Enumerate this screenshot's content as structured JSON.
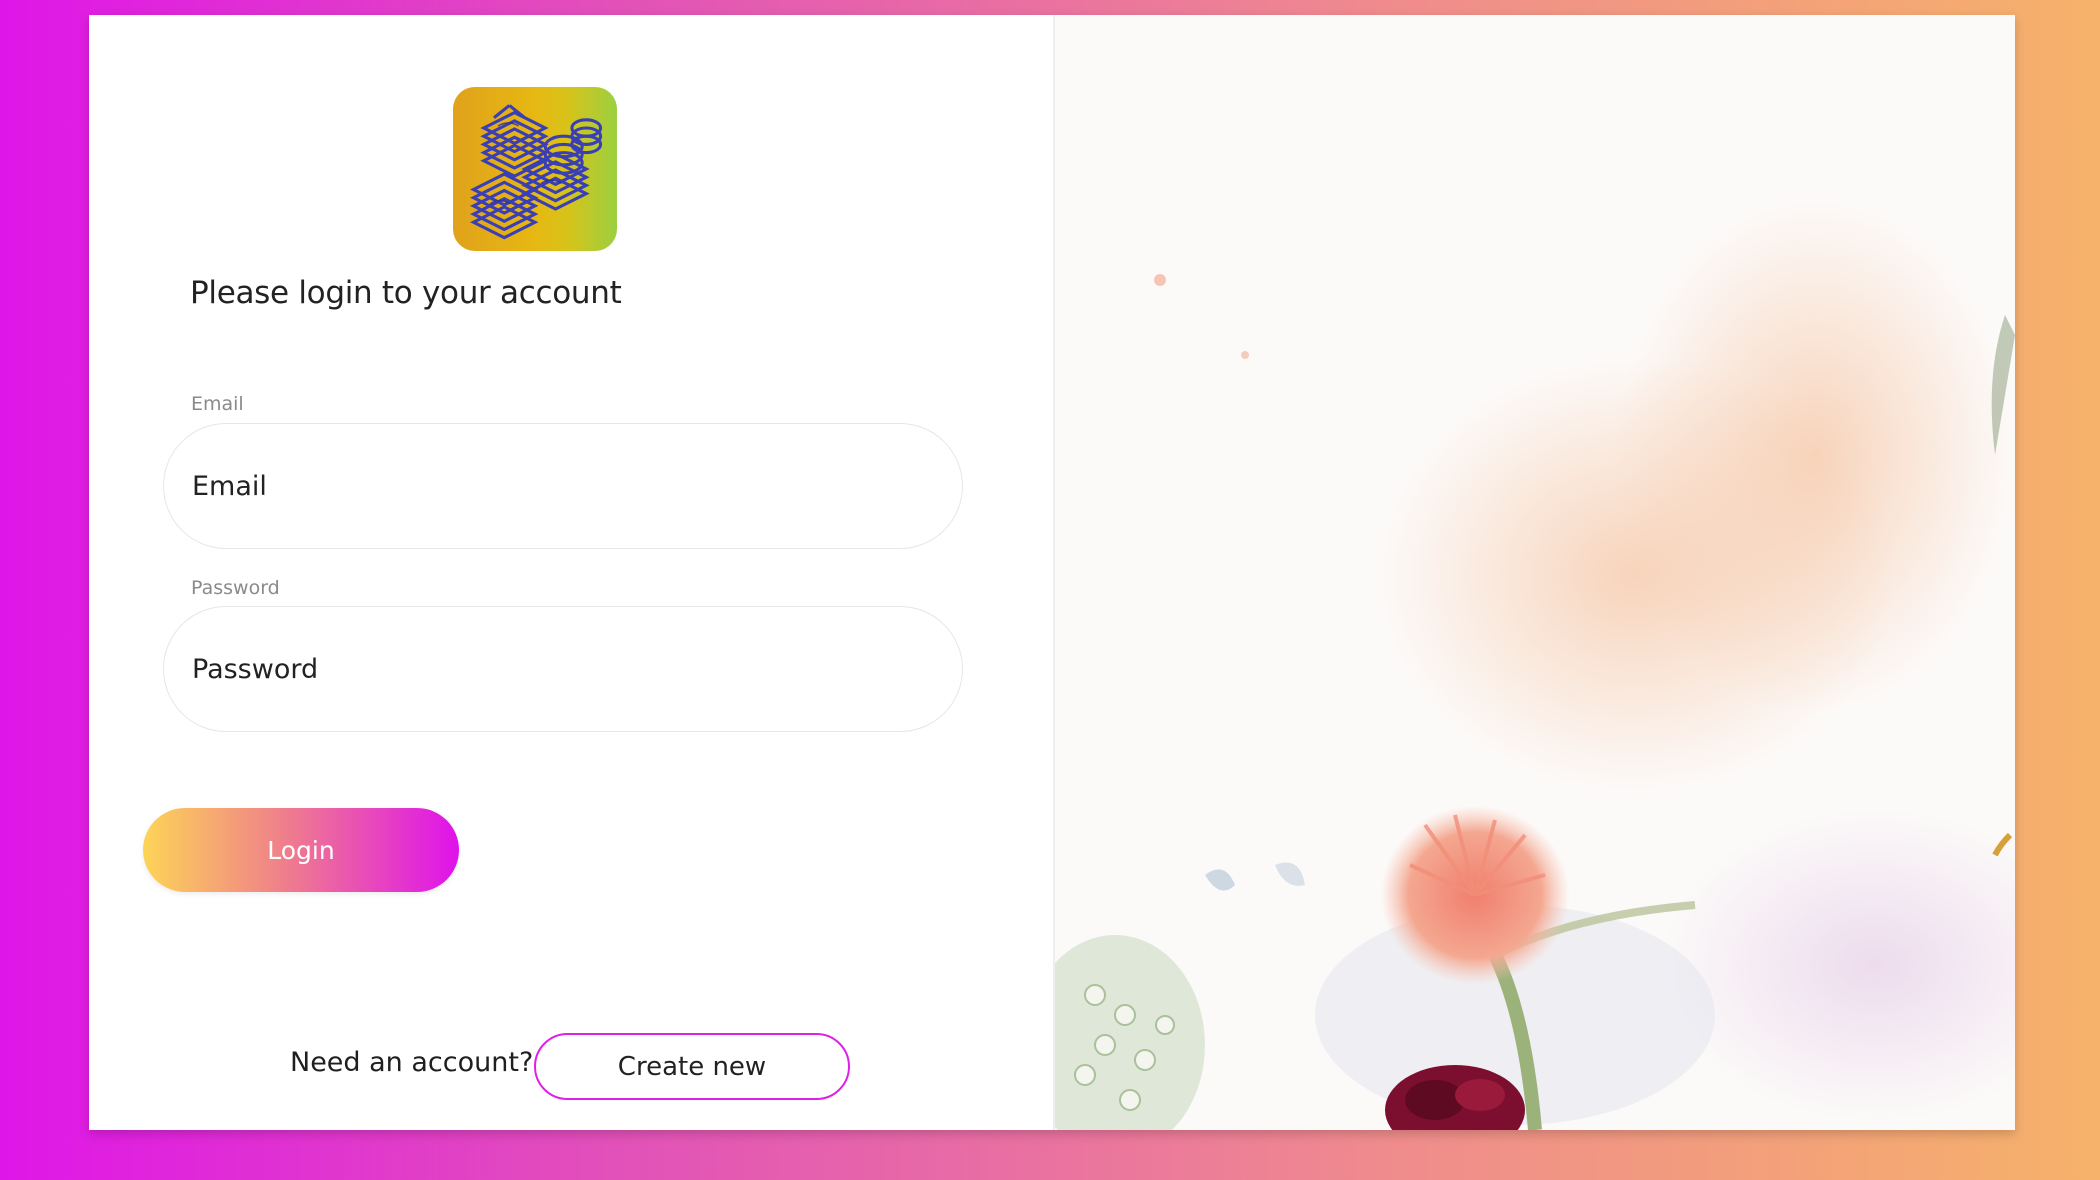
{
  "login": {
    "heading": "Please login to your account",
    "email_label": "Email",
    "email_placeholder": "Email",
    "password_label": "Password",
    "password_placeholder": "Password",
    "login_button": "Login",
    "need_account_text": "Need an account?",
    "create_button": "Create new"
  },
  "logo": {
    "icon": "big-mood-logo"
  },
  "colors": {
    "accent_magenta": "#df16e8",
    "accent_yellow": "#fdd457",
    "background_peach": "#f6b26a"
  }
}
